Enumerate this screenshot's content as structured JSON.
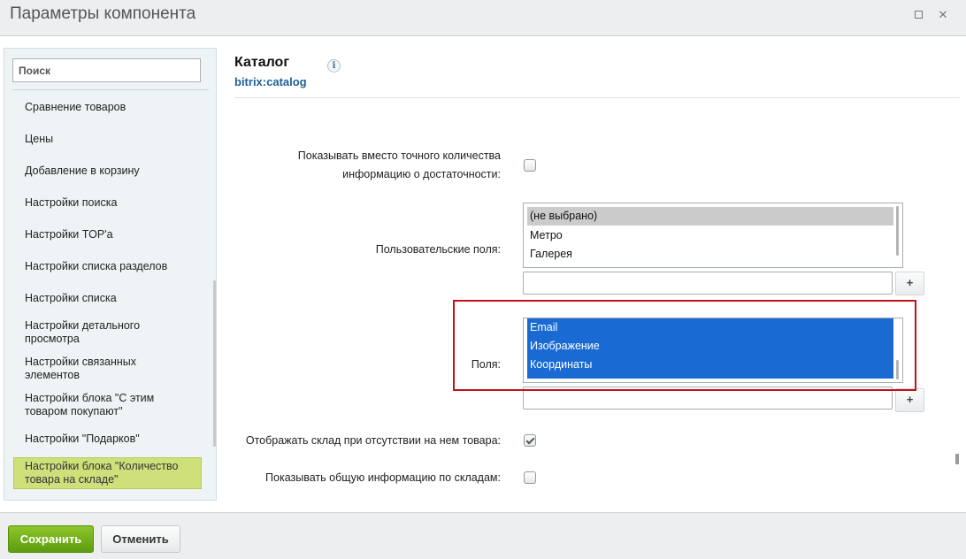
{
  "window": {
    "title": "Параметры компонента"
  },
  "sidebar": {
    "search_placeholder": "Поиск",
    "items": [
      {
        "label": "Сравнение товаров"
      },
      {
        "label": "Цены"
      },
      {
        "label": "Добавление в корзину"
      },
      {
        "label": "Настройки поиска"
      },
      {
        "label": "Настройки TOP'а"
      },
      {
        "label": "Настройки списка разделов"
      },
      {
        "label": "Настройки списка"
      },
      {
        "label": "Настройки детального просмотра"
      },
      {
        "label": "Настройки связанных элементов"
      },
      {
        "label": "Настройки блока \"С этим товаром покупают\""
      },
      {
        "label": "Настройки \"Подарков\""
      },
      {
        "label": "Настройки блока \"Количество товара на складе\""
      }
    ]
  },
  "component": {
    "title": "Каталог",
    "code": "bitrix:catalog"
  },
  "fields": {
    "show_sufficiency": {
      "label": "Показывать вместо точного количества информацию о достаточности:",
      "checked": false
    },
    "user_fields": {
      "label": "Пользовательские поля:",
      "options": [
        "(не выбрано)",
        "Метро",
        "Галерея"
      ],
      "add_label": "+"
    },
    "fields": {
      "label": "Поля:",
      "options": [
        "Email",
        "Изображение",
        "Координаты"
      ],
      "add_label": "+"
    },
    "show_store_when_empty": {
      "label": "Отображать склад при отсутствии на нем товара:",
      "checked": true
    },
    "show_general_store_info": {
      "label": "Показывать общую информацию по складам:",
      "checked": false
    }
  },
  "footer": {
    "save_label": "Сохранить",
    "cancel_label": "Отменить"
  }
}
